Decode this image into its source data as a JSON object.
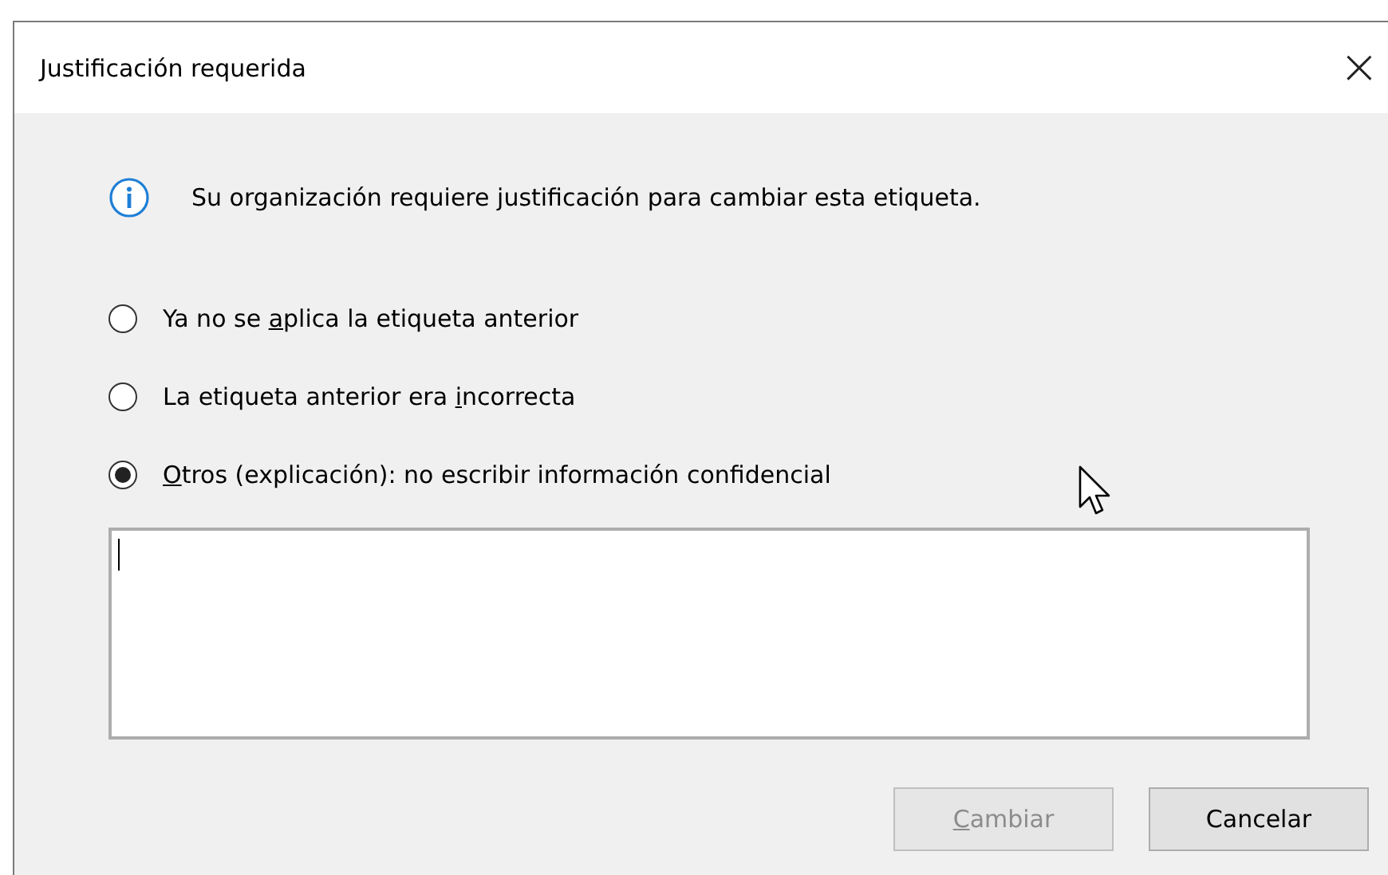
{
  "window": {
    "title": "Justificación requerida",
    "close": "×"
  },
  "info": {
    "message": "Su organización requiere justificación para cambiar esta etiqueta."
  },
  "options": [
    {
      "label_before": "Ya no se ",
      "access_key": "a",
      "label_after": "plica la etiqueta anterior",
      "selected": false
    },
    {
      "label_before": "La etiqueta anterior era ",
      "access_key": "i",
      "label_after": "ncorrecta",
      "selected": false
    },
    {
      "access_key": "O",
      "label_after": "tros (explicación): no escribir información confidencial",
      "selected": true
    }
  ],
  "explanation": {
    "focused": true
  },
  "buttons": [
    {
      "access_key": "C",
      "label_after": "ambiar",
      "disabled": true
    },
    {
      "label_before": "Cancelar",
      "disabled": false
    }
  ]
}
